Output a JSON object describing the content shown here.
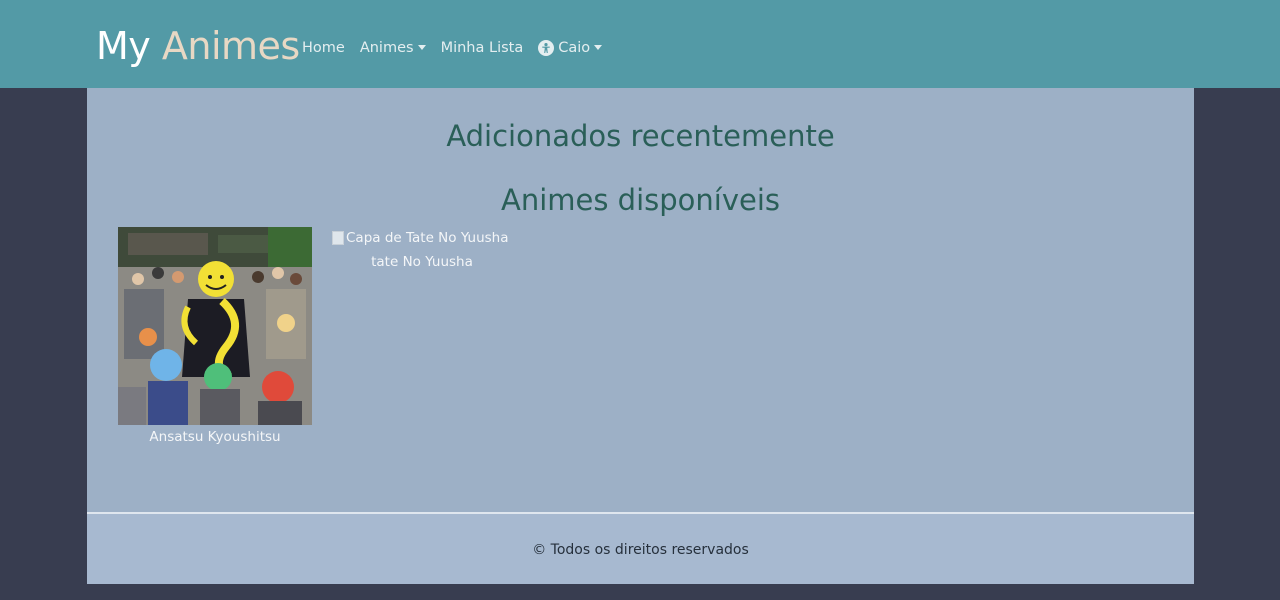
{
  "navbar": {
    "brand_part1": "My",
    "brand_part2": "Animes",
    "links": [
      {
        "label": "Home"
      },
      {
        "label": "Animes"
      },
      {
        "label": "Minha Lista"
      }
    ],
    "user": {
      "label": "Caio",
      "icon": "user-circle-icon"
    }
  },
  "main": {
    "recent_title": "Adicionados recentemente",
    "available_title": "Animes disponíveis",
    "animes": [
      {
        "title": "Ansatsu Kyoushitsu",
        "cover_alt": ""
      },
      {
        "title": "tate No Yuusha",
        "cover_alt": "Capa de Tate No Yuusha"
      }
    ]
  },
  "footer": {
    "text": "© Todos os direitos reservados"
  },
  "colors": {
    "navbar": "#539aa6",
    "page_bg": "#383d50",
    "content_bg": "#9db0c6",
    "footer_bg": "#a7b9d0",
    "heading": "#2a5f58",
    "brand_accent": "#e8d8c4"
  }
}
